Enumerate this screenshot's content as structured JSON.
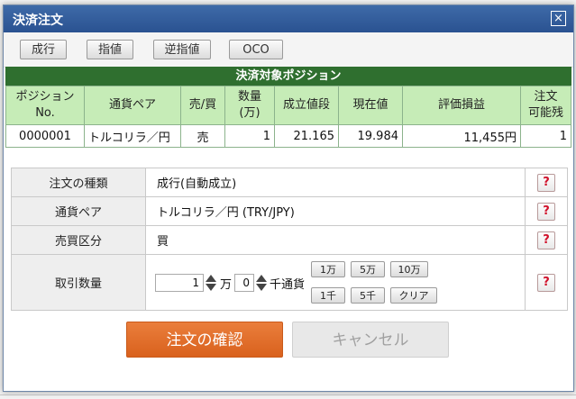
{
  "title": "決済注文",
  "close": "×",
  "toolbar": {
    "market": "成行",
    "limit": "指値",
    "stop": "逆指値",
    "oco": "OCO"
  },
  "positions": {
    "header": "決済対象ポジション",
    "columns": {
      "pos_no_1": "ポジション",
      "pos_no_2": "No.",
      "pair": "通貨ペア",
      "side": "売/買",
      "qty_1": "数量",
      "qty_2": "(万)",
      "entry": "成立値段",
      "current": "現在値",
      "pl": "評価損益",
      "avail_1": "注文",
      "avail_2": "可能残"
    },
    "row": {
      "pos_no": "0000001",
      "pair": "トルコリラ／円",
      "side": "売",
      "qty": "1",
      "entry": "21.165",
      "current": "19.984",
      "pl": "11,455円",
      "avail": "1"
    }
  },
  "form": {
    "order_type_label": "注文の種類",
    "order_type_value": "成行(自動成立)",
    "pair_label": "通貨ペア",
    "pair_value": "トルコリラ／円 (TRY/JPY)",
    "side_label": "売買区分",
    "side_value": "買",
    "qty_label": "取引数量",
    "qty_man_value": "1",
    "qty_man_unit": "万",
    "qty_sen_value": "0",
    "qty_sen_unit": "千通貨",
    "quick": {
      "b1": "1万",
      "b2": "5万",
      "b3": "10万",
      "b4": "1千",
      "b5": "5千",
      "b6": "クリア"
    },
    "help": "?"
  },
  "buttons": {
    "confirm": "注文の確認",
    "cancel": "キャンセル"
  }
}
